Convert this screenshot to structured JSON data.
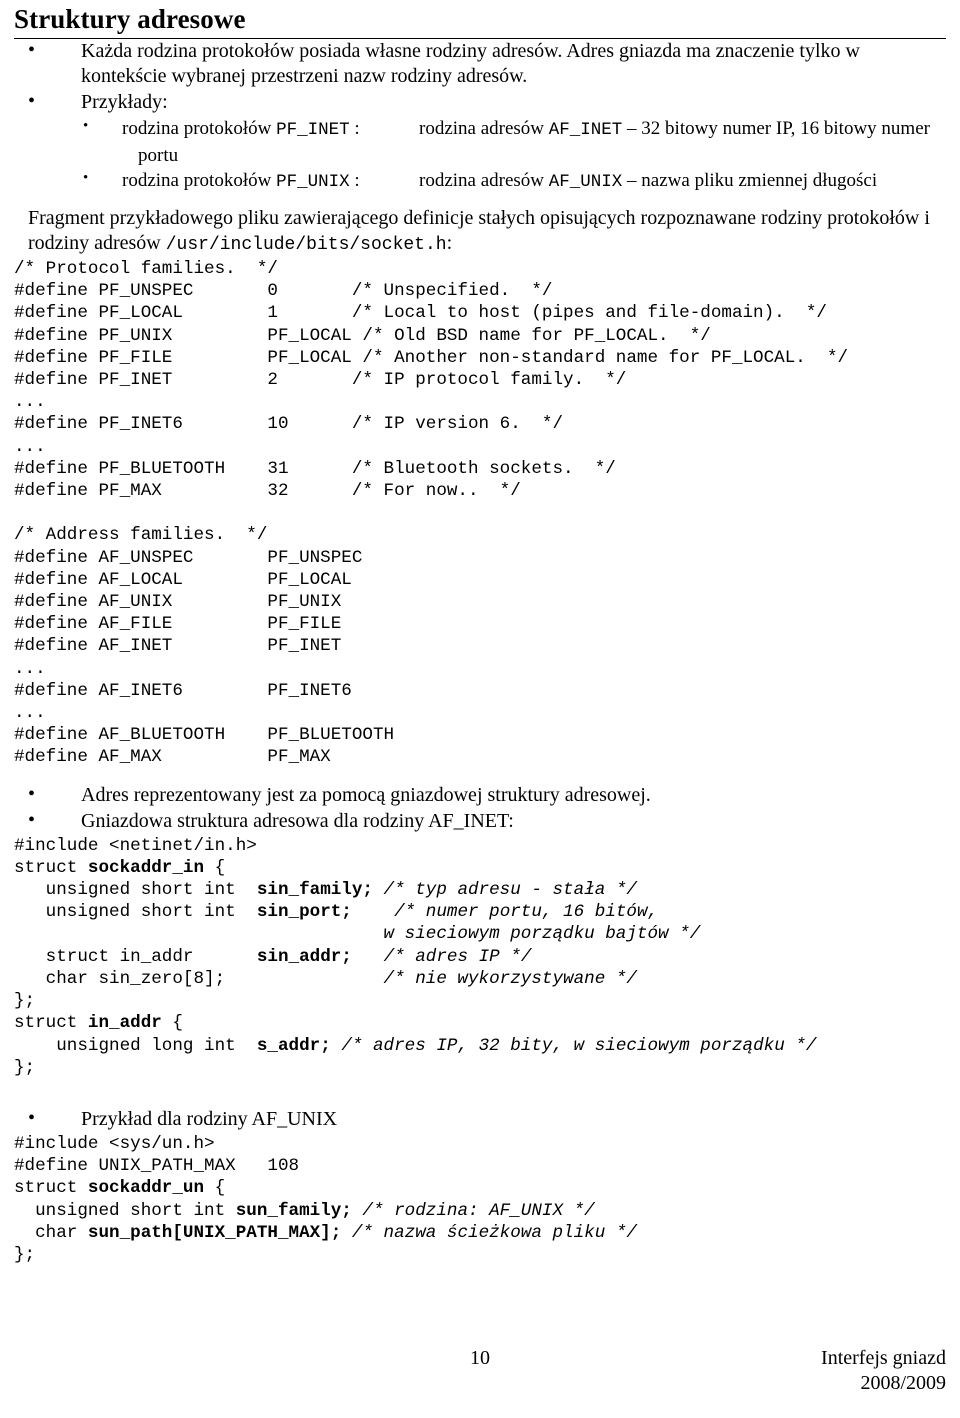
{
  "heading": "Struktury adresowe",
  "bullets_top": [
    "Każda rodzina protokołów posiada własne rodziny adresów. Adres gniazda ma znaczenie tylko w kontekście wybranej przestrzeni nazw rodziny adresów.",
    "Przykłady:"
  ],
  "examples": [
    {
      "left_prefix": "rodzina protokołów ",
      "left_code": "PF_INET",
      "left_suffix": " :",
      "right_prefix": "rodzina adresów ",
      "right_code": "AF_INET",
      "right_suffix": " – 32 bitowy numer IP, 16 bitowy numer",
      "continuation": "portu"
    },
    {
      "left_prefix": "rodzina protokołów ",
      "left_code": "PF_UNIX",
      "left_suffix": " :",
      "right_prefix": "rodzina adresów ",
      "right_code": "AF_UNIX",
      "right_suffix": " – nazwa pliku zmiennej długości",
      "continuation": ""
    }
  ],
  "paragraph": {
    "text_before": "Fragment przykładowego pliku zawierającego definicje stałych opisujących rozpoznawane rodziny protokołów i rodziny adresów ",
    "path": "/usr/include/bits/socket.h",
    "text_after": ":"
  },
  "code_socket_h": "/* Protocol families.  */\n#define PF_UNSPEC       0       /* Unspecified.  */\n#define PF_LOCAL        1       /* Local to host (pipes and file-domain).  */\n#define PF_UNIX         PF_LOCAL /* Old BSD name for PF_LOCAL.  */\n#define PF_FILE         PF_LOCAL /* Another non-standard name for PF_LOCAL.  */\n#define PF_INET         2       /* IP protocol family.  */\n...\n#define PF_INET6        10      /* IP version 6.  */\n...\n#define PF_BLUETOOTH    31      /* Bluetooth sockets.  */\n#define PF_MAX          32      /* For now..  */\n\n/* Address families.  */\n#define AF_UNSPEC       PF_UNSPEC\n#define AF_LOCAL        PF_LOCAL\n#define AF_UNIX         PF_UNIX\n#define AF_FILE         PF_FILE\n#define AF_INET         PF_INET\n...\n#define AF_INET6        PF_INET6\n...\n#define AF_BLUETOOTH    PF_BLUETOOTH\n#define AF_MAX          PF_MAX",
  "bullets_mid": [
    "Adres reprezentowany jest za pomocą gniazdowej struktury adresowej.",
    "Gniazdowa struktura adresowa dla rodziny AF_INET:"
  ],
  "code_sockaddr_in_lines": [
    [
      {
        "t": "#include <netinet/in.h>",
        "s": "plain"
      }
    ],
    [
      {
        "t": "struct ",
        "s": "plain"
      },
      {
        "t": "sockaddr_in",
        "s": "bold"
      },
      {
        "t": " {",
        "s": "plain"
      }
    ],
    [
      {
        "t": "   unsigned short int  ",
        "s": "plain"
      },
      {
        "t": "sin_family;",
        "s": "bold"
      },
      {
        "t": " ",
        "s": "plain"
      },
      {
        "t": "/* typ adresu - stała */",
        "s": "italic"
      }
    ],
    [
      {
        "t": "   unsigned short int  ",
        "s": "plain"
      },
      {
        "t": "sin_port;",
        "s": "bold"
      },
      {
        "t": "    ",
        "s": "plain"
      },
      {
        "t": "/* numer portu, 16 bitów,",
        "s": "italic"
      }
    ],
    [
      {
        "t": "                                   ",
        "s": "plain"
      },
      {
        "t": "w sieciowym porządku bajtów */",
        "s": "italic"
      }
    ],
    [
      {
        "t": "   struct in_addr      ",
        "s": "plain"
      },
      {
        "t": "sin_addr;",
        "s": "bold"
      },
      {
        "t": "   ",
        "s": "plain"
      },
      {
        "t": "/* adres IP */",
        "s": "italic"
      }
    ],
    [
      {
        "t": "   char sin_zero[8];               ",
        "s": "plain"
      },
      {
        "t": "/* nie wykorzystywane */",
        "s": "italic"
      }
    ],
    [
      {
        "t": "};",
        "s": "plain"
      }
    ],
    [
      {
        "t": "struct ",
        "s": "plain"
      },
      {
        "t": "in_addr",
        "s": "bold"
      },
      {
        "t": " {",
        "s": "plain"
      }
    ],
    [
      {
        "t": "    unsigned long int  ",
        "s": "plain"
      },
      {
        "t": "s_addr;",
        "s": "bold"
      },
      {
        "t": " ",
        "s": "plain"
      },
      {
        "t": "/* adres IP, 32 bity, w sieciowym porządku */",
        "s": "italic"
      }
    ],
    [
      {
        "t": "};",
        "s": "plain"
      }
    ]
  ],
  "bullets_unix": [
    "Przykład dla rodziny AF_UNIX"
  ],
  "code_sockaddr_un_lines": [
    [
      {
        "t": "#include <sys/un.h>",
        "s": "plain"
      }
    ],
    [
      {
        "t": "#define UNIX_PATH_MAX   108",
        "s": "plain"
      }
    ],
    [
      {
        "t": "struct ",
        "s": "plain"
      },
      {
        "t": "sockaddr_un",
        "s": "bold"
      },
      {
        "t": " {",
        "s": "plain"
      }
    ],
    [
      {
        "t": "  unsigned short int ",
        "s": "plain"
      },
      {
        "t": "sun_family;",
        "s": "bold"
      },
      {
        "t": " ",
        "s": "plain"
      },
      {
        "t": "/* rodzina: AF_UNIX */",
        "s": "italic"
      }
    ],
    [
      {
        "t": "  char ",
        "s": "plain"
      },
      {
        "t": "sun_path[UNIX_PATH_MAX];",
        "s": "bold"
      },
      {
        "t": " ",
        "s": "plain"
      },
      {
        "t": "/* nazwa ścieżkowa pliku */",
        "s": "italic"
      }
    ],
    [
      {
        "t": "};",
        "s": "plain"
      }
    ]
  ],
  "footer": {
    "page_number": "10",
    "right_line1": "Interfejs gniazd",
    "right_line2": "2008/2009"
  }
}
